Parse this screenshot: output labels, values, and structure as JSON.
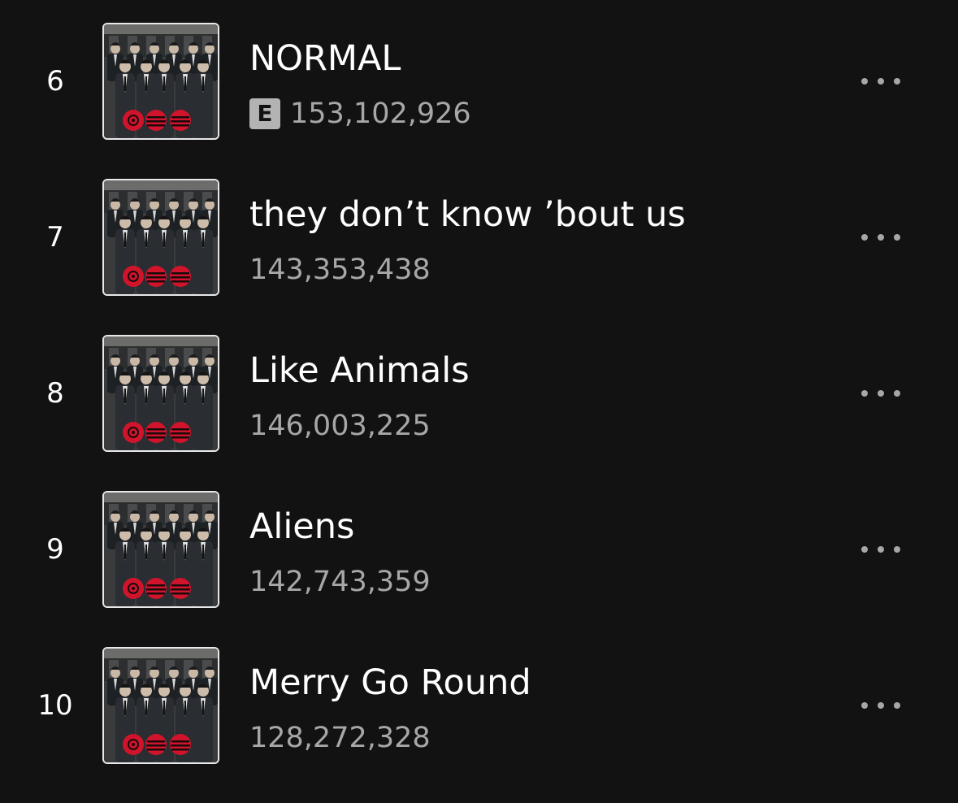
{
  "tracks": [
    {
      "number": "6",
      "title": "NORMAL",
      "explicit": true,
      "explicit_label": "E",
      "plays": "153,102,926"
    },
    {
      "number": "7",
      "title": "they don’t know ’bout us",
      "explicit": false,
      "plays": "143,353,438"
    },
    {
      "number": "8",
      "title": "Like Animals",
      "explicit": false,
      "plays": "146,003,225"
    },
    {
      "number": "9",
      "title": "Aliens",
      "explicit": false,
      "plays": "142,743,359"
    },
    {
      "number": "10",
      "title": "Merry Go Round",
      "explicit": false,
      "plays": "128,272,328"
    }
  ],
  "icons": {
    "more": "more-options-icon",
    "explicit": "explicit-badge"
  },
  "colors": {
    "background": "#121212",
    "primary_text": "#ffffff",
    "secondary_text": "#a7a7a7",
    "explicit_badge": "#b3b3b3",
    "album_accent": "#d0142c"
  }
}
